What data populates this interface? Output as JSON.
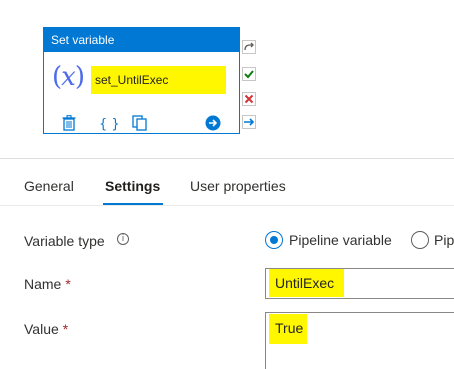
{
  "activity": {
    "header": "Set variable",
    "icon": "variable-icon",
    "icon_text": "(x)",
    "name": "set_UntilExec",
    "actions": [
      "delete-icon",
      "code-icon",
      "copy-icon",
      "arrow-right-circle-icon"
    ],
    "side_icons": [
      "redo-icon",
      "success-check-icon",
      "failure-x-icon",
      "completion-arrow-icon"
    ]
  },
  "tabs": [
    {
      "label": "General",
      "active": false
    },
    {
      "label": "Settings",
      "active": true
    },
    {
      "label": "User properties",
      "active": false
    }
  ],
  "form": {
    "variable_type": {
      "label": "Variable type",
      "info_icon": "info-icon",
      "options": [
        "Pipeline variable",
        "Pip"
      ],
      "selected": "Pipeline variable"
    },
    "name": {
      "label": "Name",
      "required": "*",
      "value": "UntilExec"
    },
    "value": {
      "label": "Value",
      "required": "*",
      "value": "True"
    }
  },
  "colors": {
    "accent": "#0078d4",
    "highlight": "#fff700",
    "required": "#a4262c"
  }
}
